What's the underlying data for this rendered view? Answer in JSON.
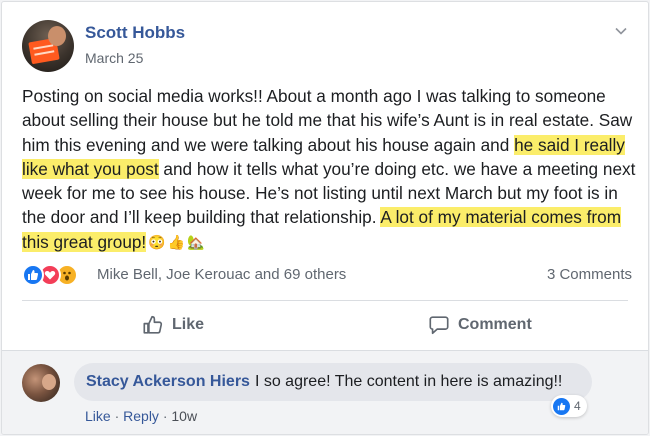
{
  "post": {
    "author": "Scott Hobbs",
    "date": "March 25",
    "text_before_hl1": "Posting on social media works!! About a month ago I was talking to someone about selling their house but he told me that his wife’s Aunt is in real estate. Saw him this evening and we were talking about his house again and ",
    "highlight1": "he said I really like what you post",
    "text_between": " and how it tells what you’re doing etc. we have a meeting next week for me to see his house. He’s not listing until next March but my foot is in the door and I’ll keep building that relationship. ",
    "highlight2": "A lot of my material comes from this great group!",
    "emojis": [
      "😳",
      "👍",
      "🏡"
    ],
    "menu_icon": "chevron-down-icon"
  },
  "reactions": {
    "icons": [
      "like-icon",
      "love-icon",
      "wow-icon"
    ],
    "names": "Mike Bell, Joe Kerouac and 69 others",
    "comments_count": "3 Comments"
  },
  "actions": {
    "like_label": "Like",
    "comment_label": "Comment"
  },
  "comment": {
    "author": "Stacy Ackerson Hiers",
    "text": "I so agree! The content in here is amazing!!",
    "like_link": "Like",
    "reply_link": "Reply",
    "separator": "·",
    "time": "10w",
    "reaction_count": "4"
  },
  "colors": {
    "link_blue": "#365899",
    "highlight": "#fbed6a",
    "like_blue": "#1877f2",
    "love_red": "#f33e58",
    "wow_yellow": "#f7b125"
  }
}
